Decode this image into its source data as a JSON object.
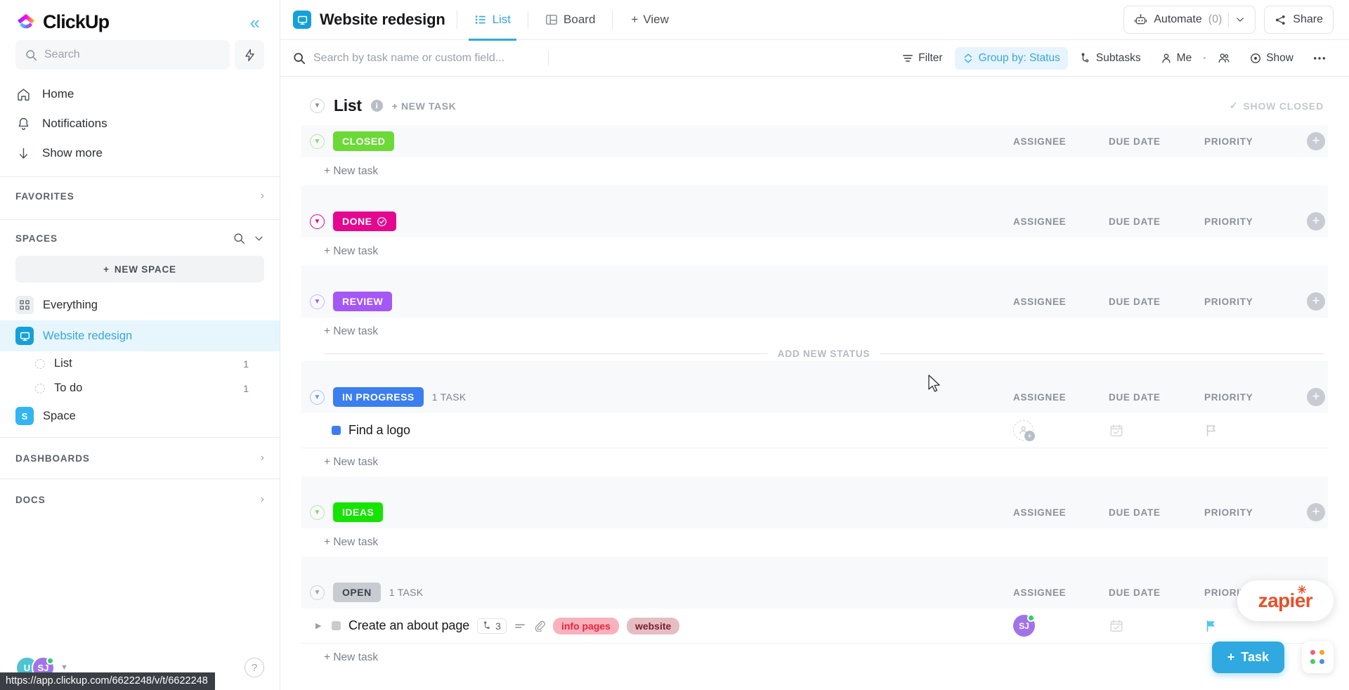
{
  "sidebar": {
    "brand": "ClickUp",
    "collapse_icon": "chevron-double-left-icon",
    "search": {
      "placeholder": "Search",
      "icon": "search-icon"
    },
    "bolt_icon": "lightning-bolt-icon",
    "nav": [
      {
        "label": "Home",
        "icon": "home-icon"
      },
      {
        "label": "Notifications",
        "icon": "bell-icon"
      },
      {
        "label": "Show more",
        "icon": "arrow-down-icon"
      }
    ],
    "favorites": {
      "label": "FAVORITES",
      "chevron": "chevron-right-icon"
    },
    "spaces": {
      "label": "SPACES",
      "search_icon": "search-icon",
      "chevron": "chevron-down-icon"
    },
    "new_space": {
      "label": "NEW SPACE",
      "icon": "plus-icon"
    },
    "items": [
      {
        "label": "Everything",
        "icon": "grid-icon",
        "badge": "",
        "type": "space",
        "color": "#eceef1",
        "initial": "",
        "active": false
      },
      {
        "label": "Website redesign",
        "icon": "monitor-icon",
        "badge": "",
        "type": "space",
        "color": "#16a0d8",
        "initial": "",
        "active": true
      },
      {
        "label": "List",
        "badge": "1",
        "type": "list",
        "active": false
      },
      {
        "label": "To do",
        "badge": "1",
        "type": "list",
        "active": false
      },
      {
        "label": "Space",
        "icon": "letter-icon",
        "badge": "",
        "type": "space",
        "color": "#32b5f0",
        "initial": "S",
        "active": false
      }
    ],
    "footer_sections": [
      {
        "label": "DASHBOARDS",
        "chevron": "chevron-right-icon"
      },
      {
        "label": "DOCS",
        "chevron": "chevron-right-icon"
      }
    ],
    "bottom": {
      "avatar1": {
        "initials": "U",
        "color": "#4fc3d0"
      },
      "avatar2": {
        "initials": "SJ",
        "color": "#a074e8"
      },
      "caret": "caret-down-icon",
      "help": "?"
    },
    "status_url": "https://app.clickup.com/6622248/v/t/6622248"
  },
  "topbar": {
    "space_icon": "monitor-icon",
    "title": "Website redesign",
    "tabs": [
      {
        "label": "List",
        "icon": "list-icon",
        "active": true
      },
      {
        "label": "Board",
        "icon": "board-icon",
        "active": false
      }
    ],
    "add_view": {
      "label": "View",
      "icon": "plus-icon"
    },
    "automate": {
      "label": "Automate",
      "count": "(0)",
      "icon": "robot-icon",
      "chevron": "chevron-down-icon"
    },
    "share": {
      "label": "Share",
      "icon": "share-icon"
    }
  },
  "toolbar": {
    "search_placeholder": "Search by task name or custom field...",
    "search_icon": "search-icon",
    "buttons": [
      {
        "label": "Filter",
        "icon": "filter-icon",
        "active": false
      },
      {
        "label": "Group by: Status",
        "icon": "sort-icon",
        "active": true
      },
      {
        "label": "Subtasks",
        "icon": "subtask-icon",
        "active": false
      },
      {
        "label": "Me",
        "icon": "person-icon",
        "active": false
      },
      {
        "label": "",
        "icon": "people-icon",
        "active": false
      },
      {
        "label": "Show",
        "icon": "eye-circle-icon",
        "active": false
      },
      {
        "label": "",
        "icon": "more-horizontal-icon",
        "active": false
      }
    ]
  },
  "list": {
    "title": "List",
    "info_icon": "info-icon",
    "new_task_label": "+ NEW TASK",
    "show_closed": {
      "label": "SHOW CLOSED",
      "icon": "check-icon"
    },
    "columns": [
      "ASSIGNEE",
      "DUE DATE",
      "PRIORITY"
    ],
    "add_column_icon": "plus-circle-icon",
    "new_task_line": "+ New task",
    "add_new_status": "ADD NEW STATUS",
    "groups": [
      {
        "status": "CLOSED",
        "color": "#6bd936",
        "border": "#6bd936",
        "count": "",
        "has_check": false,
        "tasks": []
      },
      {
        "status": "DONE",
        "color": "#e5078f",
        "border": "#e5078f",
        "count": "",
        "has_check": true,
        "tasks": []
      },
      {
        "status": "REVIEW",
        "color": "#a557f5",
        "border": "#a557f5",
        "count": "",
        "has_check": false,
        "tasks": []
      },
      {
        "status": "IN PROGRESS",
        "color": "#3b7ef0",
        "border": "#8aa8e8",
        "count": "1 TASK",
        "has_check": false,
        "tasks": [
          {
            "name": "Find a logo",
            "status_color": "#3b7ef0",
            "has_caret": false,
            "subtask_count": "",
            "tags": [],
            "assignee": {
              "initials": "",
              "color": "",
              "empty": true
            },
            "due_date_icon": "calendar-icon",
            "priority_icon": "flag-icon",
            "priority_color": "#c8ccd2"
          }
        ]
      },
      {
        "status": "IDEAS",
        "color": "#14e400",
        "border": "#6bd936",
        "count": "",
        "has_check": false,
        "tasks": []
      },
      {
        "status": "OPEN",
        "color": "#c8ccd2",
        "border": "#cfd3d9",
        "text_color": "#3c4149",
        "count": "1 TASK",
        "has_check": false,
        "tasks": [
          {
            "name": "Create an about page",
            "status_color": "#c8ccd2",
            "has_caret": true,
            "subtask_count": "3",
            "subtask_icon": "subtask-icon",
            "description_icon": "description-icon",
            "attachment_icon": "paperclip-icon",
            "tags": [
              {
                "label": "info pages",
                "bg": "#f9b2bc",
                "fg": "#e8243c"
              },
              {
                "label": "website",
                "bg": "#e7bdc4",
                "fg": "#7a1d2b"
              }
            ],
            "assignee": {
              "initials": "SJ",
              "color": "#a074e8",
              "empty": false
            },
            "due_date_icon": "calendar-icon",
            "priority_icon": "flag-icon",
            "priority_color": "#4ec8ee"
          }
        ]
      }
    ]
  },
  "floating": {
    "zapier": "zapier",
    "task_button": {
      "label": "Task",
      "icon": "plus-icon"
    },
    "apps_icon": "apps-grid-icon"
  }
}
